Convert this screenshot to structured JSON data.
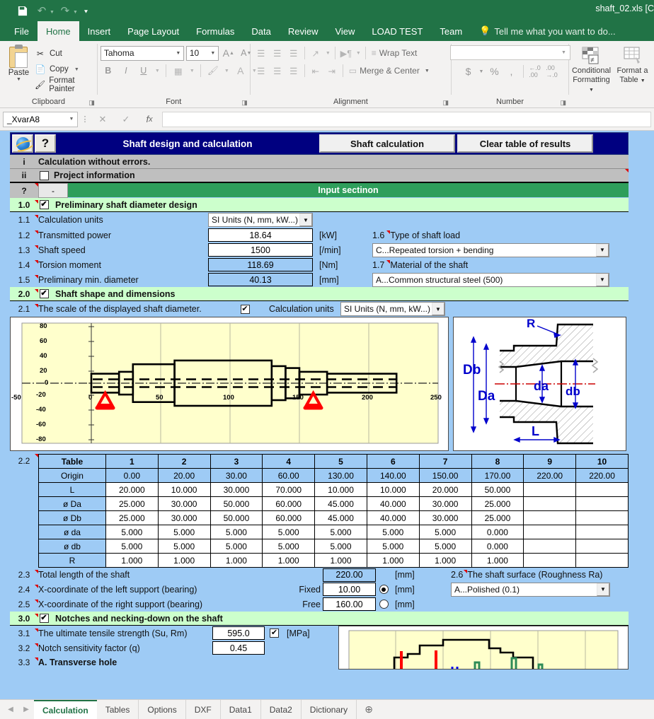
{
  "titlebar": {
    "save_icon": "save-icon",
    "undo_icon": "undo-icon",
    "redo_icon": "redo-icon",
    "customize_icon": "customize-qat-icon",
    "document_title": "shaft_02.xls  [C"
  },
  "ribbon_tabs": [
    {
      "label": "File",
      "active": false
    },
    {
      "label": "Home",
      "active": true
    },
    {
      "label": "Insert",
      "active": false
    },
    {
      "label": "Page Layout",
      "active": false
    },
    {
      "label": "Formulas",
      "active": false
    },
    {
      "label": "Data",
      "active": false
    },
    {
      "label": "Review",
      "active": false
    },
    {
      "label": "View",
      "active": false
    },
    {
      "label": "LOAD TEST",
      "active": false
    },
    {
      "label": "Team",
      "active": false
    }
  ],
  "tellme": {
    "label": "Tell me what you want to do...",
    "icon": "lightbulb-icon"
  },
  "ribbon": {
    "clipboard": {
      "group_label": "Clipboard",
      "paste_label": "Paste",
      "cut_label": "Cut",
      "copy_label": "Copy",
      "format_painter_label": "Format Painter"
    },
    "font": {
      "group_label": "Font",
      "font_name": "Tahoma",
      "font_size": "10",
      "grow_font": "A",
      "shrink_font": "A",
      "bold": "B",
      "italic": "I",
      "underline": "U"
    },
    "alignment": {
      "group_label": "Alignment",
      "wrap_text_label": "Wrap Text",
      "merge_center_label": "Merge & Center"
    },
    "number": {
      "group_label": "Number",
      "format_value": "",
      "currency": "$",
      "percent": "%",
      "comma": ",",
      "inc_dec": ".00",
      "dec_dec": ".00"
    },
    "styles": {
      "conditional_formatting": "Conditional\nFormatting",
      "conditional_formatting_l1": "Conditional",
      "conditional_formatting_l2": "Formatting",
      "format_as_table_l1": "Format a",
      "format_as_table_l2": "Table"
    }
  },
  "formula_bar": {
    "name_box": "_XvarA8",
    "cancel_icon": "cancel-icon",
    "enter_icon": "confirm-icon",
    "fx_icon": "insert-function-icon",
    "formula_value": ""
  },
  "banner": {
    "title": "Shaft design and calculation",
    "ie_icon": "internet-explorer-icon",
    "help_icon": "question-mark-icon",
    "calc_button": "Shaft calculation",
    "clear_button": "Clear table of results"
  },
  "status": {
    "row_i": "i",
    "row_i_text": "Calculation without errors.",
    "row_ii": "ii",
    "row_ii_text": "Project information",
    "row_ii_checked": false,
    "row_q": "?",
    "row_dash": "-",
    "input_section": "Input sectinon"
  },
  "section1": {
    "no": "1.0",
    "title": "Preliminary shaft diameter design",
    "checked": true,
    "rows": [
      {
        "no": "1.1",
        "label": "Calculation units",
        "type": "dropdown",
        "value": "SI Units (N, mm, kW...)"
      },
      {
        "no": "1.2",
        "label": "Transmitted power",
        "type": "input",
        "value": "18.64",
        "unit": "[kW]"
      },
      {
        "no": "1.3",
        "label": "Shaft speed",
        "type": "input",
        "value": "1500",
        "unit": "[/min]"
      },
      {
        "no": "1.4",
        "label": "Torsion moment",
        "type": "result",
        "value": "118.69",
        "unit": "[Nm]"
      },
      {
        "no": "1.5",
        "label": "Preliminary min. diameter",
        "type": "result",
        "value": "40.13",
        "unit": "[mm]"
      }
    ],
    "right": [
      {
        "no": "1.6",
        "label": "Type of shaft load",
        "value": "C...Repeated torsion + bending"
      },
      {
        "no": "1.7",
        "label": "Material of the shaft",
        "value": "A...Common structural steel  (500)"
      }
    ]
  },
  "section2": {
    "no": "2.0",
    "title": "Shaft shape and dimensions",
    "checked": true,
    "row21": {
      "no": "2.1",
      "label": "The scale of the displayed shaft diameter.",
      "checked": true,
      "units_label": "Calculation units",
      "units_value": "SI Units (N, mm, kW...)"
    },
    "row22_no": "2.2",
    "table": {
      "corner_label": "Table",
      "columns": [
        "1",
        "2",
        "3",
        "4",
        "5",
        "6",
        "7",
        "8",
        "9",
        "10"
      ],
      "rows": [
        {
          "label": "Origin",
          "values": [
            "0.00",
            "20.00",
            "30.00",
            "60.00",
            "130.00",
            "140.00",
            "150.00",
            "170.00",
            "220.00",
            "220.00"
          ],
          "style": "origin"
        },
        {
          "label": "L",
          "values": [
            "20.000",
            "10.000",
            "30.000",
            "70.000",
            "10.000",
            "10.000",
            "20.000",
            "50.000",
            "",
            ""
          ],
          "style": "val"
        },
        {
          "label": "ø Da",
          "values": [
            "25.000",
            "30.000",
            "50.000",
            "60.000",
            "45.000",
            "40.000",
            "30.000",
            "25.000",
            "",
            ""
          ],
          "style": "val"
        },
        {
          "label": "ø Db",
          "values": [
            "25.000",
            "30.000",
            "50.000",
            "60.000",
            "45.000",
            "40.000",
            "30.000",
            "25.000",
            "",
            ""
          ],
          "style": "val"
        },
        {
          "label": "ø da",
          "values": [
            "5.000",
            "5.000",
            "5.000",
            "5.000",
            "5.000",
            "5.000",
            "5.000",
            "0.000",
            "",
            ""
          ],
          "style": "val"
        },
        {
          "label": "ø db",
          "values": [
            "5.000",
            "5.000",
            "5.000",
            "5.000",
            "5.000",
            "5.000",
            "5.000",
            "0.000",
            "",
            ""
          ],
          "style": "val"
        },
        {
          "label": "R",
          "values": [
            "1.000",
            "1.000",
            "1.000",
            "1.000",
            "1.000",
            "1.000",
            "1.000",
            "1.000",
            "",
            ""
          ],
          "style": "val"
        }
      ]
    },
    "rows_bottom": [
      {
        "no": "2.3",
        "label": "Total length of the shaft",
        "tag": "",
        "value": "220.00",
        "unit": "[mm]",
        "radio": "none"
      },
      {
        "no": "2.4",
        "label": "X-coordinate of the left support (bearing)",
        "tag": "Fixed",
        "value": "10.00",
        "unit": "[mm]",
        "radio": "on"
      },
      {
        "no": "2.5",
        "label": "X-coordinate of the right support (bearing)",
        "tag": "Free",
        "value": "160.00",
        "unit": "[mm]",
        "radio": "off"
      }
    ],
    "row26": {
      "no": "2.6",
      "label": "The shaft surface (Roughness Ra)",
      "value": "A...Polished  (0.1)"
    }
  },
  "section3": {
    "no": "3.0",
    "title": "Notches and necking-down on the shaft",
    "checked": true,
    "rows": [
      {
        "no": "3.1",
        "label": "The ultimate tensile strength (Su, Rm)",
        "value": "595.0",
        "checked": true,
        "unit": "[MPa]"
      },
      {
        "no": "3.2",
        "label": "Notch sensitivity factor (q)",
        "value": "0.45",
        "checked": null,
        "unit": ""
      },
      {
        "no": "3.3",
        "label": "A. Transverse hole",
        "value": "",
        "checked": null,
        "unit": ""
      }
    ]
  },
  "sheet_tabs": {
    "prev_icon": "prev-sheet-icon",
    "next_icon": "next-sheet-icon",
    "add_icon": "add-sheet-icon",
    "tabs": [
      {
        "label": "Calculation",
        "active": true
      },
      {
        "label": "Tables",
        "active": false
      },
      {
        "label": "Options",
        "active": false
      },
      {
        "label": "DXF",
        "active": false
      },
      {
        "label": "Data1",
        "active": false
      },
      {
        "label": "Data2",
        "active": false
      },
      {
        "label": "Dictionary",
        "active": false
      }
    ]
  },
  "chart_data": {
    "type": "line",
    "title": "",
    "xlabel": "",
    "ylabel": "",
    "xlim": [
      -50,
      250
    ],
    "ylim": [
      -80,
      80
    ],
    "xticks": [
      -50,
      0,
      50,
      100,
      150,
      200,
      250
    ],
    "yticks": [
      -80,
      -60,
      -40,
      -20,
      0,
      20,
      40,
      60,
      80
    ],
    "grid": true,
    "plot_bgcolor": "#ffffcc",
    "series": [
      {
        "name": "Shaft profile (radius vs x)",
        "segments": [
          {
            "x_start": 0,
            "x_end": 20,
            "radius": 12.5
          },
          {
            "x_start": 20,
            "x_end": 30,
            "radius": 15.0
          },
          {
            "x_start": 30,
            "x_end": 60,
            "radius": 25.0
          },
          {
            "x_start": 60,
            "x_end": 130,
            "radius": 30.0
          },
          {
            "x_start": 130,
            "x_end": 140,
            "radius": 22.5
          },
          {
            "x_start": 140,
            "x_end": 150,
            "radius": 20.0
          },
          {
            "x_start": 150,
            "x_end": 170,
            "radius": 15.0
          },
          {
            "x_start": 170,
            "x_end": 220,
            "radius": 12.5
          }
        ]
      }
    ],
    "annotations": [
      {
        "type": "support-marker",
        "label": "left support",
        "x": 10,
        "color": "#ff0000"
      },
      {
        "type": "support-marker",
        "label": "right support",
        "x": 160,
        "color": "#ff0000"
      },
      {
        "type": "centerline",
        "label": "axis",
        "y": 0,
        "style": "dash-dot"
      }
    ]
  },
  "diagram": {
    "labels": [
      "R",
      "Db",
      "Da",
      "da",
      "db",
      "L"
    ],
    "accent_color": "#0000cc",
    "centerline_color": "#cc0000"
  }
}
